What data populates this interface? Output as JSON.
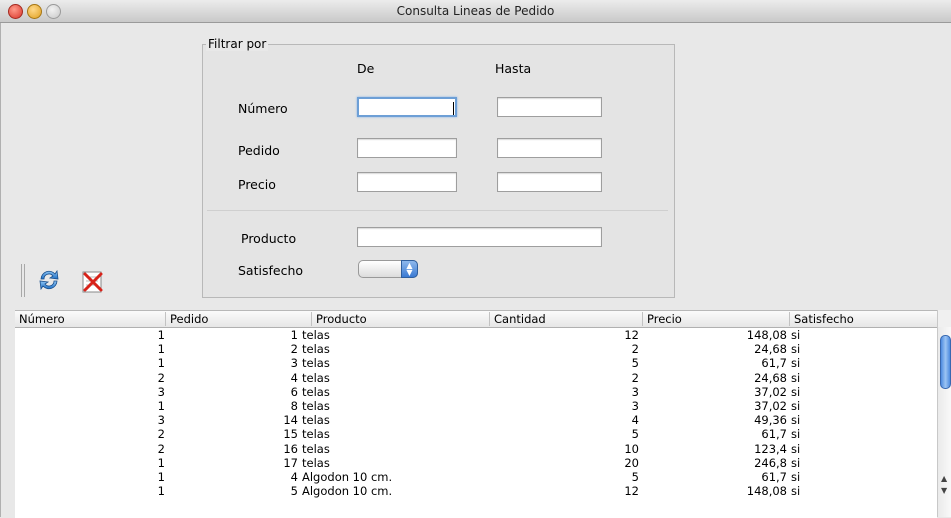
{
  "window": {
    "title": "Consulta Lineas de Pedido"
  },
  "filter": {
    "legend": "Filtrar por",
    "col_from": "De",
    "col_to": "Hasta",
    "numero_label": "Número",
    "pedido_label": "Pedido",
    "precio_label": "Precio",
    "producto_label": "Producto",
    "satisfecho_label": "Satisfecho",
    "numero_from": "",
    "numero_to": "",
    "pedido_from": "",
    "pedido_to": "",
    "precio_from": "",
    "precio_to": "",
    "producto": "",
    "satisfecho_selected": ""
  },
  "toolbar": {
    "refresh_icon": "refresh-icon",
    "clear_icon": "clear-filter-icon"
  },
  "table": {
    "columns": [
      "Número",
      "Pedido",
      "Producto",
      "Cantidad",
      "Precio",
      "Satisfecho"
    ],
    "rows": [
      {
        "numero": "1",
        "pedido": "1",
        "producto": "telas",
        "cantidad": "12",
        "precio": "148,08",
        "satisfecho": "si"
      },
      {
        "numero": "1",
        "pedido": "2",
        "producto": "telas",
        "cantidad": "2",
        "precio": "24,68",
        "satisfecho": "si"
      },
      {
        "numero": "1",
        "pedido": "3",
        "producto": "telas",
        "cantidad": "5",
        "precio": "61,7",
        "satisfecho": "si"
      },
      {
        "numero": "2",
        "pedido": "4",
        "producto": "telas",
        "cantidad": "2",
        "precio": "24,68",
        "satisfecho": "si"
      },
      {
        "numero": "3",
        "pedido": "6",
        "producto": "telas",
        "cantidad": "3",
        "precio": "37,02",
        "satisfecho": "si"
      },
      {
        "numero": "1",
        "pedido": "8",
        "producto": "telas",
        "cantidad": "3",
        "precio": "37,02",
        "satisfecho": "si"
      },
      {
        "numero": "3",
        "pedido": "14",
        "producto": "telas",
        "cantidad": "4",
        "precio": "49,36",
        "satisfecho": "si"
      },
      {
        "numero": "2",
        "pedido": "15",
        "producto": "telas",
        "cantidad": "5",
        "precio": "61,7",
        "satisfecho": "si"
      },
      {
        "numero": "2",
        "pedido": "16",
        "producto": "telas",
        "cantidad": "10",
        "precio": "123,4",
        "satisfecho": "si"
      },
      {
        "numero": "1",
        "pedido": "17",
        "producto": "telas",
        "cantidad": "20",
        "precio": "246,8",
        "satisfecho": "si"
      },
      {
        "numero": "1",
        "pedido": "4",
        "producto": "Algodon 10 cm.",
        "cantidad": "5",
        "precio": "61,7",
        "satisfecho": "si"
      },
      {
        "numero": "1",
        "pedido": "5",
        "producto": "Algodon 10 cm.",
        "cantidad": "12",
        "precio": "148,08",
        "satisfecho": "si"
      }
    ]
  }
}
